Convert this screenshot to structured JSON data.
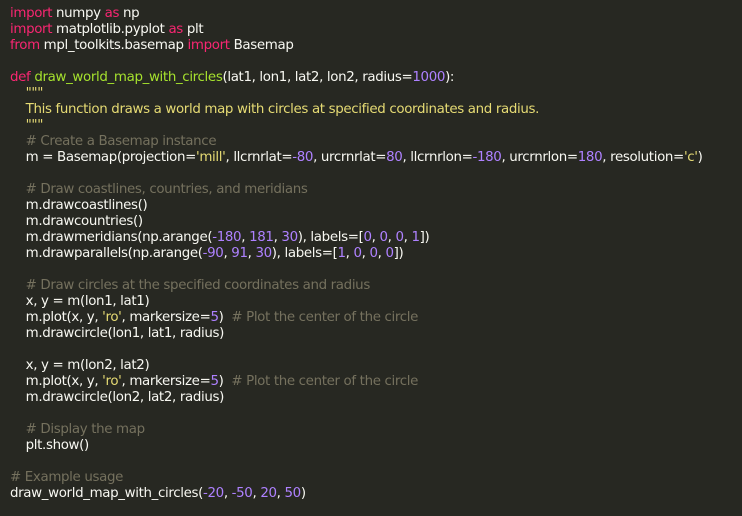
{
  "editor": {
    "theme_colors": {
      "background": "#272822",
      "keyword": "#f92672",
      "function": "#a6e22e",
      "string": "#e6db74",
      "number": "#ae81ff",
      "comment": "#75715e",
      "plain": "#f8f8f2"
    },
    "lines": [
      [
        {
          "t": "kw",
          "v": "import"
        },
        {
          "t": "pl",
          "v": " numpy "
        },
        {
          "t": "kw",
          "v": "as"
        },
        {
          "t": "pl",
          "v": " np"
        }
      ],
      [
        {
          "t": "kw",
          "v": "import"
        },
        {
          "t": "pl",
          "v": " matplotlib.pyplot "
        },
        {
          "t": "kw",
          "v": "as"
        },
        {
          "t": "pl",
          "v": " plt"
        }
      ],
      [
        {
          "t": "kw",
          "v": "from"
        },
        {
          "t": "pl",
          "v": " mpl_toolkits.basemap "
        },
        {
          "t": "kw",
          "v": "import"
        },
        {
          "t": "pl",
          "v": " Basemap"
        }
      ],
      [],
      [
        {
          "t": "kw",
          "v": "def"
        },
        {
          "t": "pl",
          "v": " "
        },
        {
          "t": "fn",
          "v": "draw_world_map_with_circles"
        },
        {
          "t": "pl",
          "v": "(lat1, lon1, lat2, lon2, radius="
        },
        {
          "t": "num",
          "v": "1000"
        },
        {
          "t": "pl",
          "v": "):"
        }
      ],
      [
        {
          "t": "str",
          "v": "    \"\"\""
        }
      ],
      [
        {
          "t": "str",
          "v": "    This function draws a world map with circles at specified coordinates and radius."
        }
      ],
      [
        {
          "t": "str",
          "v": "    \"\"\""
        }
      ],
      [
        {
          "t": "cm",
          "v": "    # Create a Basemap instance"
        }
      ],
      [
        {
          "t": "pl",
          "v": "    m = Basemap(projection="
        },
        {
          "t": "str",
          "v": "'mill'"
        },
        {
          "t": "pl",
          "v": ", llcrnrlat="
        },
        {
          "t": "num",
          "v": "-80"
        },
        {
          "t": "pl",
          "v": ", urcrnrlat="
        },
        {
          "t": "num",
          "v": "80"
        },
        {
          "t": "pl",
          "v": ", llcrnrlon="
        },
        {
          "t": "num",
          "v": "-180"
        },
        {
          "t": "pl",
          "v": ", urcrnrlon="
        },
        {
          "t": "num",
          "v": "180"
        },
        {
          "t": "pl",
          "v": ", resolution="
        },
        {
          "t": "str",
          "v": "'c'"
        },
        {
          "t": "pl",
          "v": ")"
        }
      ],
      [],
      [
        {
          "t": "cm",
          "v": "    # Draw coastlines, countries, and meridians"
        }
      ],
      [
        {
          "t": "pl",
          "v": "    m.drawcoastlines()"
        }
      ],
      [
        {
          "t": "pl",
          "v": "    m.drawcountries()"
        }
      ],
      [
        {
          "t": "pl",
          "v": "    m.drawmeridians(np.arange("
        },
        {
          "t": "num",
          "v": "-180"
        },
        {
          "t": "pl",
          "v": ", "
        },
        {
          "t": "num",
          "v": "181"
        },
        {
          "t": "pl",
          "v": ", "
        },
        {
          "t": "num",
          "v": "30"
        },
        {
          "t": "pl",
          "v": "), labels=["
        },
        {
          "t": "num",
          "v": "0"
        },
        {
          "t": "pl",
          "v": ", "
        },
        {
          "t": "num",
          "v": "0"
        },
        {
          "t": "pl",
          "v": ", "
        },
        {
          "t": "num",
          "v": "0"
        },
        {
          "t": "pl",
          "v": ", "
        },
        {
          "t": "num",
          "v": "1"
        },
        {
          "t": "pl",
          "v": "])"
        }
      ],
      [
        {
          "t": "pl",
          "v": "    m.drawparallels(np.arange("
        },
        {
          "t": "num",
          "v": "-90"
        },
        {
          "t": "pl",
          "v": ", "
        },
        {
          "t": "num",
          "v": "91"
        },
        {
          "t": "pl",
          "v": ", "
        },
        {
          "t": "num",
          "v": "30"
        },
        {
          "t": "pl",
          "v": "), labels=["
        },
        {
          "t": "num",
          "v": "1"
        },
        {
          "t": "pl",
          "v": ", "
        },
        {
          "t": "num",
          "v": "0"
        },
        {
          "t": "pl",
          "v": ", "
        },
        {
          "t": "num",
          "v": "0"
        },
        {
          "t": "pl",
          "v": ", "
        },
        {
          "t": "num",
          "v": "0"
        },
        {
          "t": "pl",
          "v": "])"
        }
      ],
      [],
      [
        {
          "t": "cm",
          "v": "    # Draw circles at the specified coordinates and radius"
        }
      ],
      [
        {
          "t": "pl",
          "v": "    x, y = m(lon1, lat1)"
        }
      ],
      [
        {
          "t": "pl",
          "v": "    m.plot(x, y, "
        },
        {
          "t": "str",
          "v": "'ro'"
        },
        {
          "t": "pl",
          "v": ", markersize="
        },
        {
          "t": "num",
          "v": "5"
        },
        {
          "t": "pl",
          "v": ")  "
        },
        {
          "t": "cm",
          "v": "# Plot the center of the circle"
        }
      ],
      [
        {
          "t": "pl",
          "v": "    m.drawcircle(lon1, lat1, radius)"
        }
      ],
      [],
      [
        {
          "t": "pl",
          "v": "    x, y = m(lon2, lat2)"
        }
      ],
      [
        {
          "t": "pl",
          "v": "    m.plot(x, y, "
        },
        {
          "t": "str",
          "v": "'ro'"
        },
        {
          "t": "pl",
          "v": ", markersize="
        },
        {
          "t": "num",
          "v": "5"
        },
        {
          "t": "pl",
          "v": ")  "
        },
        {
          "t": "cm",
          "v": "# Plot the center of the circle"
        }
      ],
      [
        {
          "t": "pl",
          "v": "    m.drawcircle(lon2, lat2, radius)"
        }
      ],
      [],
      [
        {
          "t": "cm",
          "v": "    # Display the map"
        }
      ],
      [
        {
          "t": "pl",
          "v": "    plt.show()"
        }
      ],
      [],
      [
        {
          "t": "cm",
          "v": "# Example usage"
        }
      ],
      [
        {
          "t": "pl",
          "v": "draw_world_map_with_circles("
        },
        {
          "t": "num",
          "v": "-20"
        },
        {
          "t": "pl",
          "v": ", "
        },
        {
          "t": "num",
          "v": "-50"
        },
        {
          "t": "pl",
          "v": ", "
        },
        {
          "t": "num",
          "v": "20"
        },
        {
          "t": "pl",
          "v": ", "
        },
        {
          "t": "num",
          "v": "50"
        },
        {
          "t": "pl",
          "v": ")"
        }
      ]
    ]
  }
}
